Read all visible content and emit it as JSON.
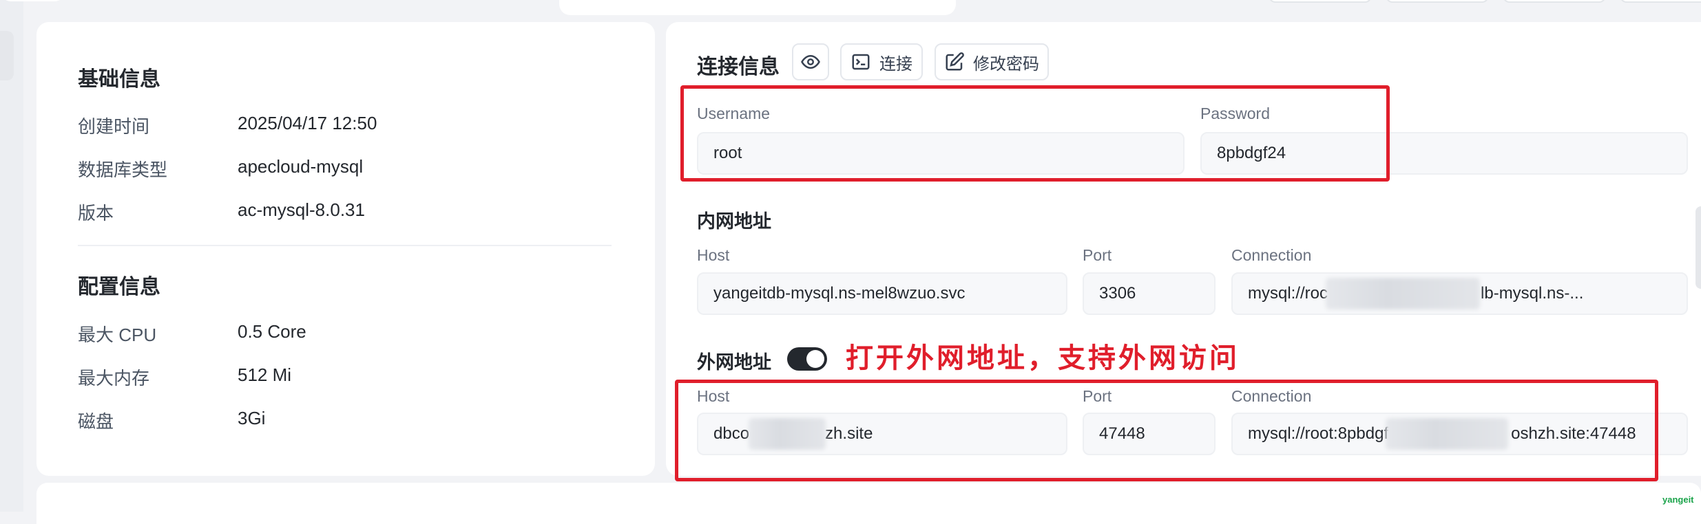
{
  "basic": {
    "title": "基础信息",
    "rows": [
      {
        "label": "创建时间",
        "value": "2025/04/17 12:50"
      },
      {
        "label": "数据库类型",
        "value": "apecloud-mysql"
      },
      {
        "label": "版本",
        "value": "ac-mysql-8.0.31"
      }
    ]
  },
  "config": {
    "title": "配置信息",
    "rows": [
      {
        "label": "最大 CPU",
        "value": "0.5 Core"
      },
      {
        "label": "最大内存",
        "value": "512 Mi"
      },
      {
        "label": "磁盘",
        "value": "3Gi"
      }
    ]
  },
  "connection": {
    "title": "连接信息",
    "connect_label": "连接",
    "change_password_label": "修改密码",
    "username_label": "Username",
    "username_value": "root",
    "password_label": "Password",
    "password_value": "8pbdgf24"
  },
  "internal": {
    "title": "内网地址",
    "host_label": "Host",
    "host_value": "yangeitdb-mysql.ns-mel8wzuo.svc",
    "port_label": "Port",
    "port_value": "3306",
    "connection_label": "Connection",
    "connection_value_start": "mysql://roc",
    "connection_value_end": "lb-mysql.ns-..."
  },
  "external": {
    "title": "外网地址",
    "enabled": true,
    "host_label": "Host",
    "host_value_start": "dbco",
    "host_value_end": "zh.site",
    "port_label": "Port",
    "port_value": "47448",
    "connection_label": "Connection",
    "connection_value_start": "mysql://root:8pbdgf",
    "connection_value_end": "oshzh.site:47448"
  },
  "annotation": "打开外网地址，支持外网访问",
  "watermark": "yangeit",
  "colors": {
    "accent": "#e01e2b",
    "toggle_on": "#24282e"
  }
}
